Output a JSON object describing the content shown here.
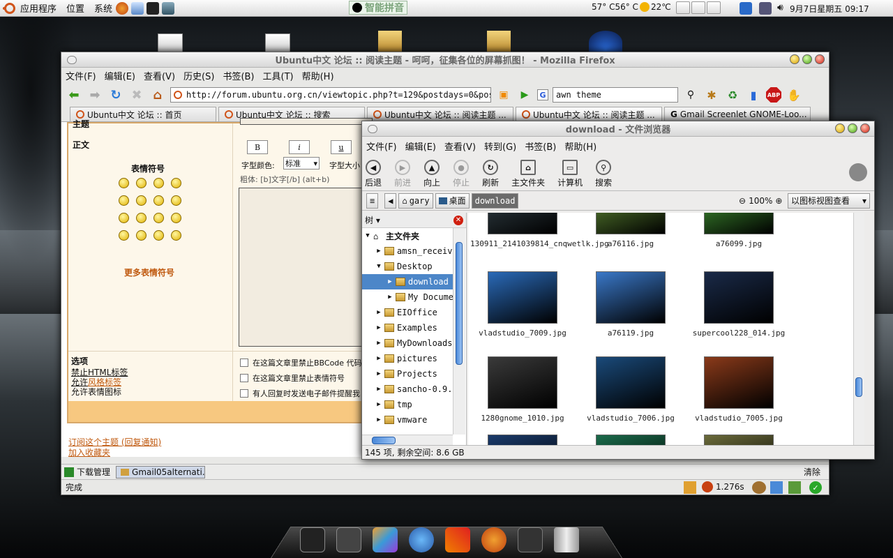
{
  "top_panel": {
    "apps_menu": "应用程序",
    "places_menu": "位置",
    "system_menu": "系统",
    "ime": "智能拼音",
    "temps": "57° C56° C",
    "weather": "22℃",
    "clock": "9月7日星期五 09:17"
  },
  "firefox": {
    "title": "Ubuntu中文 论坛 :: 阅读主题 - 呵呵，征集各位的屏幕抓图！ - Mozilla Firefox",
    "menu": [
      "文件(F)",
      "编辑(E)",
      "查看(V)",
      "历史(S)",
      "书签(B)",
      "工具(T)",
      "帮助(H)"
    ],
    "url": "http://forum.ubuntu.org.cn/viewtopic.php?t=129&postdays=0&postorder=asc",
    "search_value": "awn theme",
    "tabs": [
      "Ubuntu中文 论坛 :: 首页",
      "Ubuntu中文 论坛 :: 搜索",
      "Ubuntu中文 论坛 :: 阅读主题 ...",
      "Ubuntu中文 论坛 :: 阅读主题 ...",
      "Gmail Screenlet GNOME-Loo..."
    ],
    "form": {
      "subject_label": "主题",
      "body_label": "正文",
      "emoticons_label": "表情符号",
      "more_emoticons": "更多表情符号",
      "bold": "B",
      "italic": "i",
      "underline": "u",
      "font_color_label": "字型颜色:",
      "font_color_value": "标准",
      "font_size_label": "字型大小",
      "bold_hint": "粗体: [b]文字[/b]  (alt+b)",
      "options_label": "选项",
      "opt_html": "禁止HTML标签",
      "opt_bbcode_prefix": "允许",
      "opt_bbcode_link": "风格标签",
      "opt_smilies": "允许表情图标",
      "check1": "在这篇文章里禁止BBCode 代码",
      "check2": "在这篇文章里禁止表情符号",
      "check3": "有人回复时发送电子邮件提醒我"
    },
    "subscribe": "订阅这个主题 (回复通知)",
    "bookmark": "加入收藏夹",
    "downloads_label": "下载管理",
    "download_item": "Gmail05alternati...",
    "clear": "清除",
    "status": "完成",
    "timer": "1.276s"
  },
  "nautilus": {
    "title": "download - 文件浏览器",
    "menu": [
      "文件(F)",
      "编辑(E)",
      "查看(V)",
      "转到(G)",
      "书签(B)",
      "帮助(H)"
    ],
    "toolbar": [
      {
        "label": "后退",
        "enabled": true
      },
      {
        "label": "前进",
        "enabled": false
      },
      {
        "label": "向上",
        "enabled": true
      },
      {
        "label": "停止",
        "enabled": false
      },
      {
        "label": "刷新",
        "enabled": true
      },
      {
        "label": "主文件夹",
        "enabled": true
      },
      {
        "label": "计算机",
        "enabled": true
      },
      {
        "label": "搜索",
        "enabled": true
      }
    ],
    "crumbs": [
      "gary",
      "桌面",
      "download"
    ],
    "zoom": "100%",
    "view_mode": "以图标视图查看",
    "side_label": "树",
    "tree": [
      {
        "label": "主文件夹",
        "depth": 0
      },
      {
        "label": "amsn_receiv",
        "depth": 1
      },
      {
        "label": "Desktop",
        "depth": 1
      },
      {
        "label": "download",
        "depth": 2,
        "selected": true
      },
      {
        "label": "My Docume",
        "depth": 2
      },
      {
        "label": "EIOffice",
        "depth": 1
      },
      {
        "label": "Examples",
        "depth": 1
      },
      {
        "label": "MyDownloads",
        "depth": 1
      },
      {
        "label": "pictures",
        "depth": 1
      },
      {
        "label": "Projects",
        "depth": 1
      },
      {
        "label": "sancho-0.9.",
        "depth": 1
      },
      {
        "label": "tmp",
        "depth": 1
      },
      {
        "label": "vmware",
        "depth": 1
      }
    ],
    "files": [
      {
        "name": "130911_2141039814_cnqwetlk.jpg",
        "color": "#3a4a52"
      },
      {
        "name": "a76116.jpg",
        "color": "#6a9a3a"
      },
      {
        "name": "a76099.jpg",
        "color": "#4aa83a"
      },
      {
        "name": "vladstudio_7009.jpg",
        "color": "#2a6ab8"
      },
      {
        "name": "a76119.jpg",
        "color": "#3a78c8"
      },
      {
        "name": "supercool228_014.jpg",
        "color": "#1a2a48"
      },
      {
        "name": "1280gnome_1010.jpg",
        "color": "#3a3a3a"
      },
      {
        "name": "vladstudio_7006.jpg",
        "color": "#1a4a7a"
      },
      {
        "name": "vladstudio_7005.jpg",
        "color": "#8a3a1a"
      },
      {
        "name": "",
        "color": "#1a3a6a"
      },
      {
        "name": "",
        "color": "#1a6a4a"
      },
      {
        "name": "",
        "color": "#6a6a3a"
      }
    ],
    "status": "145 项, 剩余空间: 8.6 GB"
  },
  "dock": {
    "items": [
      "terminal-icon",
      "root-terminal-icon",
      "art-icon",
      "messenger-icon",
      "chat-icon",
      "firefox-icon",
      "shell-icon",
      "trash-icon"
    ]
  }
}
